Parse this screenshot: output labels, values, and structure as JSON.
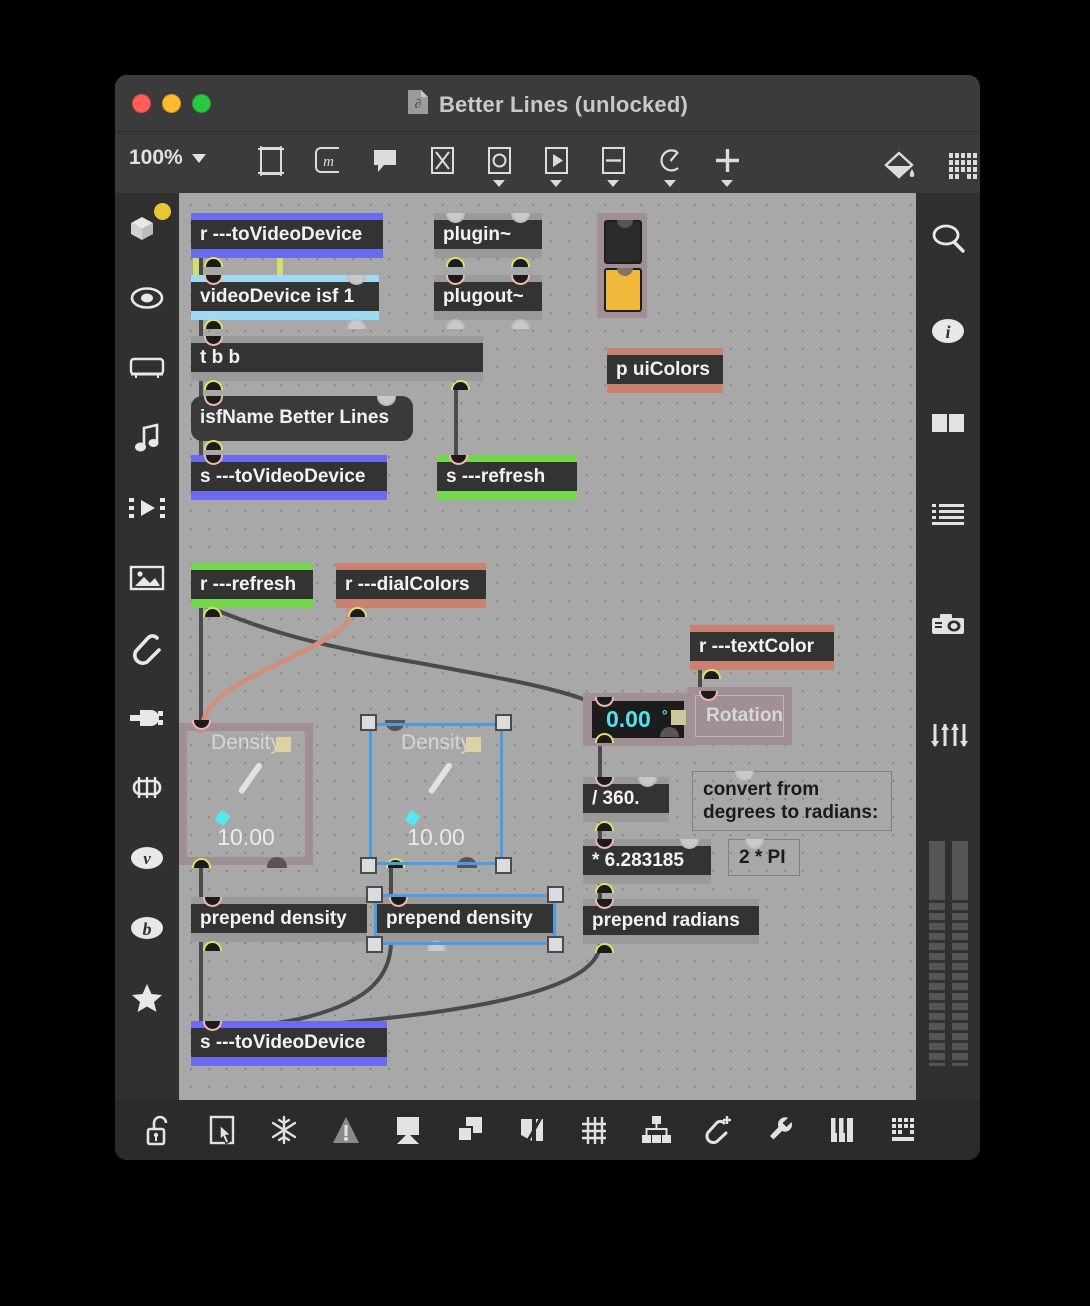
{
  "window": {
    "title": "Better Lines (unlocked)",
    "file_icon": "patcher-file-icon",
    "traffic_lights": [
      "close",
      "minimize",
      "zoom"
    ]
  },
  "toolbar": {
    "zoom_level": "100%",
    "zoom_caret": "chevron-down-icon",
    "buttons": [
      {
        "name": "object-palette-icon",
        "has_menu": false
      },
      {
        "name": "message-object-icon",
        "has_menu": false
      },
      {
        "name": "comment-object-icon",
        "has_menu": false
      },
      {
        "name": "toggle-object-icon",
        "has_menu": false
      },
      {
        "name": "button-object-icon",
        "has_menu": true
      },
      {
        "name": "playbar-object-icon",
        "has_menu": true
      },
      {
        "name": "slider-object-icon",
        "has_menu": true
      },
      {
        "name": "dial-object-icon",
        "has_menu": true
      },
      {
        "name": "add-object-icon",
        "has_menu": true
      },
      {
        "name": "paint-bucket-icon",
        "has_menu": false
      },
      {
        "name": "grid-palette-icon",
        "has_menu": false
      }
    ]
  },
  "left_sidebar": {
    "items": [
      {
        "name": "packages-icon",
        "badge": true
      },
      {
        "name": "snapshot-icon",
        "badge": false
      },
      {
        "name": "keyboard-icon",
        "badge": false
      },
      {
        "name": "music-note-icon",
        "badge": false
      },
      {
        "name": "video-clip-icon",
        "badge": false
      },
      {
        "name": "image-icon",
        "badge": false
      },
      {
        "name": "paperclip-icon",
        "badge": false
      },
      {
        "name": "plug-icon",
        "badge": false
      },
      {
        "name": "chip-icon",
        "badge": false
      },
      {
        "name": "vizzie-icon",
        "badge": false,
        "glyph": "v"
      },
      {
        "name": "beap-icon",
        "badge": false,
        "glyph": "b"
      },
      {
        "name": "favorites-star-icon",
        "badge": false
      }
    ]
  },
  "right_sidebar": {
    "items": [
      {
        "name": "search-icon"
      },
      {
        "name": "info-icon"
      },
      {
        "name": "panels-icon"
      },
      {
        "name": "list-icon"
      },
      {
        "name": "camera-icon"
      },
      {
        "name": "mixer-sliders-icon"
      },
      {
        "name": "audio-meters"
      }
    ]
  },
  "bottom_toolbar": {
    "buttons": [
      {
        "name": "unlock-padlock-icon"
      },
      {
        "name": "edit-cursor-icon"
      },
      {
        "name": "freeze-snowflake-icon"
      },
      {
        "name": "warning-triangle-icon"
      },
      {
        "name": "presentation-mode-icon"
      },
      {
        "name": "duplicate-icon"
      },
      {
        "name": "align-icon"
      },
      {
        "name": "grid-icon"
      },
      {
        "name": "distribute-icon"
      },
      {
        "name": "add-attachment-icon"
      },
      {
        "name": "wrench-inspector-icon"
      },
      {
        "name": "keyboard-piano-icon"
      },
      {
        "name": "matrix-grid-icon"
      }
    ]
  },
  "patch": {
    "objects": [
      {
        "id": "r_tovideodevice_top",
        "text": "r ---toVideoDevice",
        "border": "#6b6bf0"
      },
      {
        "id": "videodevice",
        "text": "videoDevice isf 1",
        "border": "#9fd9f2"
      },
      {
        "id": "tbb",
        "text": "t b b",
        "border": "#9a9a9a"
      },
      {
        "id": "isfname",
        "text": "isfName Better Lines",
        "border": "#4a4a4a"
      },
      {
        "id": "s_tovideodevice_top",
        "text": "s ---toVideoDevice",
        "border": "#6b6bf0"
      },
      {
        "id": "plugin",
        "text": "plugin~",
        "border": "#9a9a9a"
      },
      {
        "id": "plugout",
        "text": "plugout~",
        "border": "#9a9a9a"
      },
      {
        "id": "s_refresh",
        "text": "s ---refresh",
        "border": "#74d64a"
      },
      {
        "id": "p_uicolors",
        "text": "p uiColors",
        "border": "#c9826f"
      },
      {
        "id": "r_refresh",
        "text": "r ---refresh",
        "border": "#74d64a"
      },
      {
        "id": "r_dialcolors",
        "text": "r ---dialColors",
        "border": "#c9826f"
      },
      {
        "id": "r_textcolor",
        "text": "r ---textColor",
        "border": "#c9826f"
      },
      {
        "id": "div360",
        "text": "/ 360.",
        "border": "#9a9a9a"
      },
      {
        "id": "mult",
        "text": "* 6.283185",
        "border": "#9a9a9a"
      },
      {
        "id": "prepend_density_1",
        "text": "prepend density",
        "border": "#9a9a9a"
      },
      {
        "id": "prepend_density_2",
        "text": "prepend density",
        "border": "#9a9a9a"
      },
      {
        "id": "prepend_radians",
        "text": "prepend radians",
        "border": "#9a9a9a"
      },
      {
        "id": "s_tovideodevice_bottom",
        "text": "s ---toVideoDevice",
        "border": "#6b6bf0"
      }
    ],
    "comments": [
      {
        "id": "comment_convert",
        "line1": "convert from",
        "line2": "degrees to radians:"
      },
      {
        "id": "comment_twopi",
        "text": "2 * PI"
      },
      {
        "id": "rotation_label",
        "text": "Rotation"
      }
    ],
    "dials": [
      {
        "id": "dial_left",
        "label": "Density",
        "value": "10.00",
        "selected": false
      },
      {
        "id": "dial_right",
        "label": "Density",
        "value": "10.00",
        "selected": true
      }
    ],
    "number_box": {
      "id": "rotation_number",
      "value": "0.00",
      "unit": "°"
    },
    "swatches": [
      {
        "id": "swatch_dark",
        "color": "#2b2b2b"
      },
      {
        "id": "swatch_yellow",
        "color": "#f0b93c"
      }
    ]
  },
  "colors": {
    "canvas": "#a8a8a8",
    "object_body": "#333333",
    "send_receive_blue": "#6b6bf0",
    "refresh_green": "#74d64a",
    "dialcolors_salmon": "#c9826f",
    "videodevice_lightblue": "#9fd9f2",
    "selection_blue": "#4a9de0",
    "number_cyan": "#4fe3ef",
    "signal_cord": "#d2e06a",
    "patch_cord": "#4a4a4a"
  }
}
